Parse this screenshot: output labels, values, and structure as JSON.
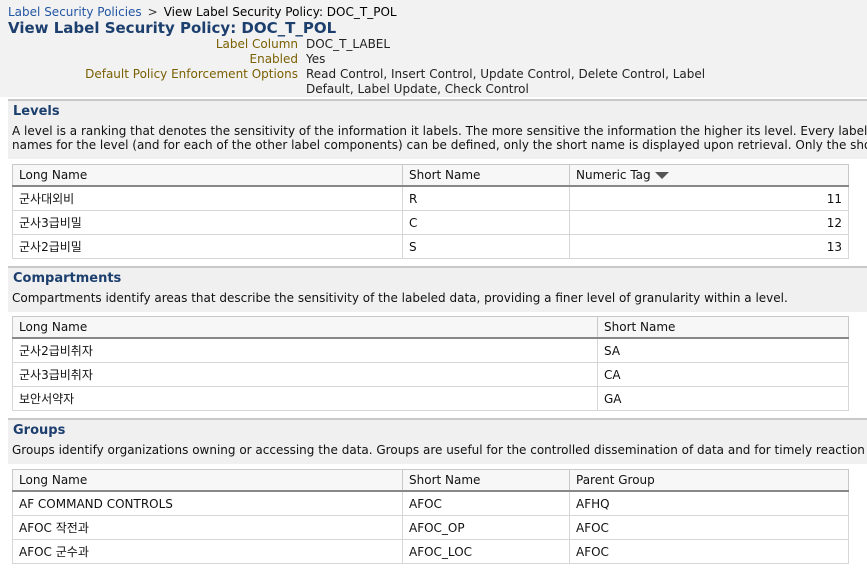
{
  "breadcrumb": {
    "link": "Label Security Policies",
    "separator": ">",
    "current": "View Label Security Policy: DOC_T_POL"
  },
  "page_title": "View Label Security Policy: DOC_T_POL",
  "properties": [
    {
      "label": "Label Column",
      "value": "DOC_T_LABEL"
    },
    {
      "label": "Enabled",
      "value": "Yes"
    },
    {
      "label": "Default Policy Enforcement Options",
      "value": "Read Control, Insert Control, Update Control, Delete Control, Label Default, Label Update, Check Control"
    }
  ],
  "levels": {
    "heading": "Levels",
    "desc1": "A level is a ranking that denotes the sensitivity of the information it labels. The more sensitive the information the higher its level. Every label must include one le",
    "desc2": "names for the level (and for each of the other label components) can be defined, only the short name is displayed upon retrieval. Only the short names are used",
    "columns": [
      "Long Name",
      "Short Name",
      "Numeric Tag"
    ],
    "rows": [
      [
        "군사대외비",
        "R",
        "11"
      ],
      [
        "군사3급비밀",
        "C",
        "12"
      ],
      [
        "군사2급비밀",
        "S",
        "13"
      ]
    ]
  },
  "compartments": {
    "heading": "Compartments",
    "desc1": "Compartments identify areas that describe the sensitivity of the labeled data, providing a finer level of granularity within a level.",
    "columns": [
      "Long Name",
      "Short Name"
    ],
    "rows": [
      [
        "군사2급비취자",
        "SA"
      ],
      [
        "군사3급비취자",
        "CA"
      ],
      [
        "보안서약자",
        "GA"
      ]
    ]
  },
  "groups": {
    "heading": "Groups",
    "desc1": "Groups identify organizations owning or accessing the data. Groups are useful for the controlled dissemination of data and for timely reaction to organizational",
    "columns": [
      "Long Name",
      "Short Name",
      "Parent Group"
    ],
    "rows": [
      [
        "AF COMMAND CONTROLS",
        "AFOC",
        "AFHQ"
      ],
      [
        "AFOC 작전과",
        "AFOC_OP",
        "AFOC"
      ],
      [
        "AFOC 군수과",
        "AFOC_LOC",
        "AFOC"
      ]
    ]
  },
  "icons": {
    "sort": "sort-descending-icon"
  }
}
